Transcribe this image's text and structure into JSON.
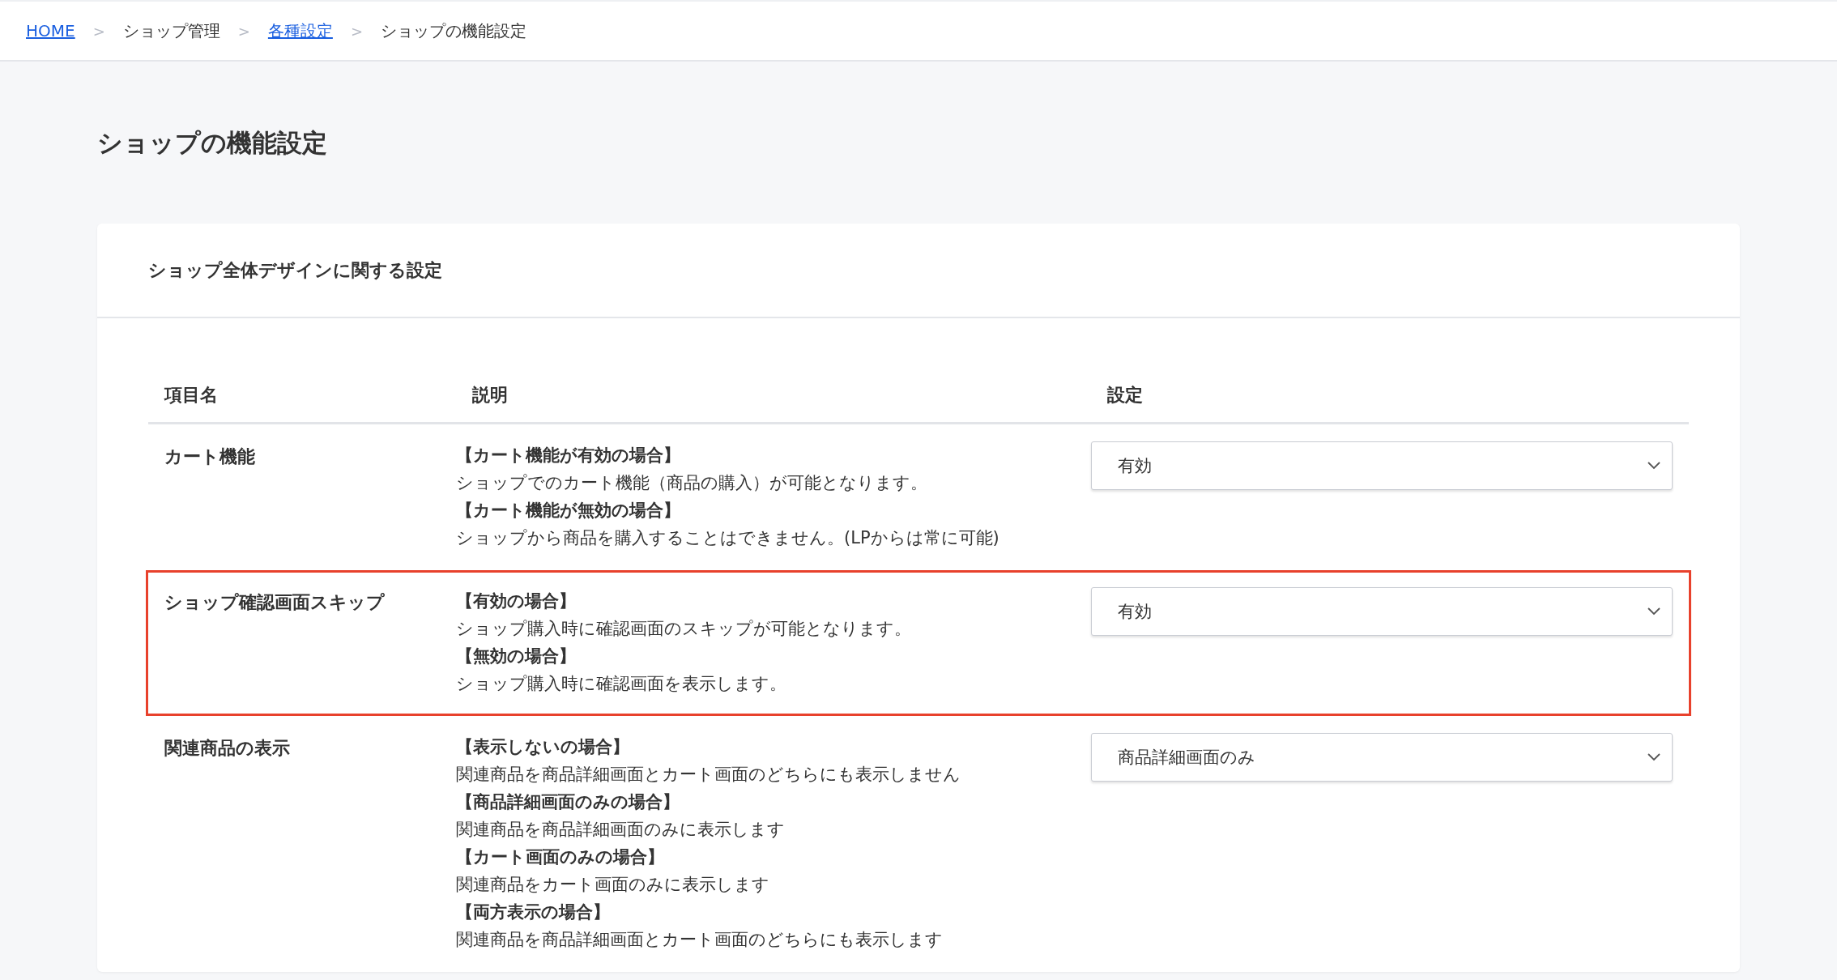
{
  "breadcrumb": [
    {
      "label": "HOME",
      "link": true
    },
    {
      "label": "ショップ管理",
      "link": false
    },
    {
      "label": "各種設定",
      "link": true
    },
    {
      "label": "ショップの機能設定",
      "link": false
    }
  ],
  "breadcrumb_separator": ">",
  "page_title": "ショップの機能設定",
  "card": {
    "title": "ショップ全体デザインに関する設定",
    "table": {
      "columns": [
        "項目名",
        "説明",
        "設定"
      ],
      "rows": [
        {
          "name": "カート機能",
          "highlighted": false,
          "description": [
            {
              "kind": "heading",
              "text": "【カート機能が有効の場合】"
            },
            {
              "kind": "text",
              "text": "ショップでのカート機能（商品の購入）が可能となります。"
            },
            {
              "kind": "heading",
              "text": "【カート機能が無効の場合】"
            },
            {
              "kind": "text",
              "text": "ショップから商品を購入することはできません。(LPからは常に可能)"
            }
          ],
          "setting": "有効"
        },
        {
          "name": "ショップ確認画面スキップ",
          "highlighted": true,
          "description": [
            {
              "kind": "heading",
              "text": "【有効の場合】"
            },
            {
              "kind": "text",
              "text": "ショップ購入時に確認画面のスキップが可能となります。"
            },
            {
              "kind": "heading",
              "text": "【無効の場合】"
            },
            {
              "kind": "text",
              "text": "ショップ購入時に確認画面を表示します。"
            }
          ],
          "setting": "有効"
        },
        {
          "name": "関連商品の表示",
          "highlighted": false,
          "description": [
            {
              "kind": "heading",
              "text": "【表示しないの場合】"
            },
            {
              "kind": "text",
              "text": "関連商品を商品詳細画面とカート画面のどちらにも表示しません"
            },
            {
              "kind": "heading",
              "text": "【商品詳細画面のみの場合】"
            },
            {
              "kind": "text",
              "text": "関連商品を商品詳細画面のみに表示します"
            },
            {
              "kind": "heading",
              "text": "【カート画面のみの場合】"
            },
            {
              "kind": "text",
              "text": "関連商品をカート画面のみに表示します"
            },
            {
              "kind": "heading",
              "text": "【両方表示の場合】"
            },
            {
              "kind": "text",
              "text": "関連商品を商品詳細画面とカート画面のどちらにも表示します"
            }
          ],
          "setting": "商品詳細画面のみ"
        }
      ]
    }
  }
}
